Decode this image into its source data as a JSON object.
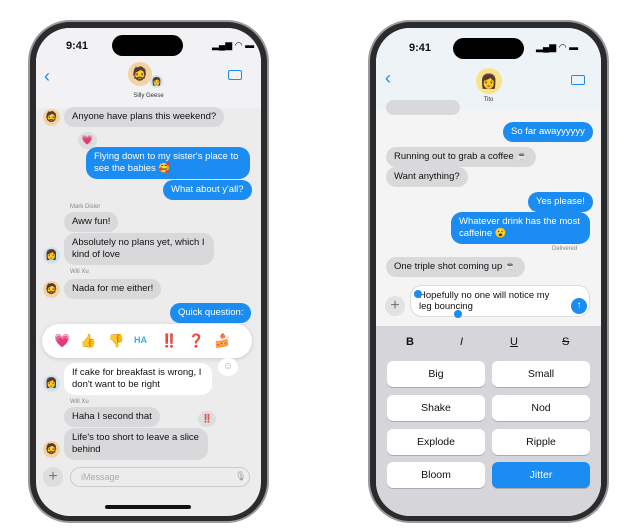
{
  "left": {
    "time": "9:41",
    "group_name": "Silly Geese",
    "messages": [
      "Anyone have plans this weekend?",
      "Flying down to my sister's place to see the babies 🥰",
      "What about y'all?",
      "Aww fun!",
      "Absolutely no plans yet, which I kind of love",
      "Nada for me either!",
      "Quick question:",
      "If cake for breakfast is wrong, I don't want to be right",
      "Haha I second that",
      "Life's too short to leave a slice behind"
    ],
    "senders": [
      "Mark Disler",
      "Will Xu",
      "Will Xu"
    ],
    "tapbacks": [
      "💗",
      "‼️"
    ],
    "reactions": [
      "💗",
      "👍",
      "👎",
      "HA",
      "‼️",
      "❓",
      "🍰"
    ],
    "input_placeholder": "iMessage"
  },
  "right": {
    "time": "9:41",
    "contact_name": "Tito",
    "messages": [
      "So far awayyyyyy",
      "Running out to grab a coffee ☕",
      "Want anything?",
      "Yes please!",
      "Whatever drink has the most caffeine 😮",
      "One triple shot coming up ☕"
    ],
    "status": "Delivered",
    "draft_text": "Hopefully no one will notice my leg bouncing",
    "format": [
      "B",
      "I",
      "U",
      "S"
    ],
    "effects": [
      "Big",
      "Small",
      "Shake",
      "Nod",
      "Explode",
      "Ripple",
      "Bloom",
      "Jitter"
    ],
    "selected_effect": "Jitter"
  },
  "colors": {
    "accent": "#1a8cf2",
    "incoming": "#d9d9dc"
  }
}
